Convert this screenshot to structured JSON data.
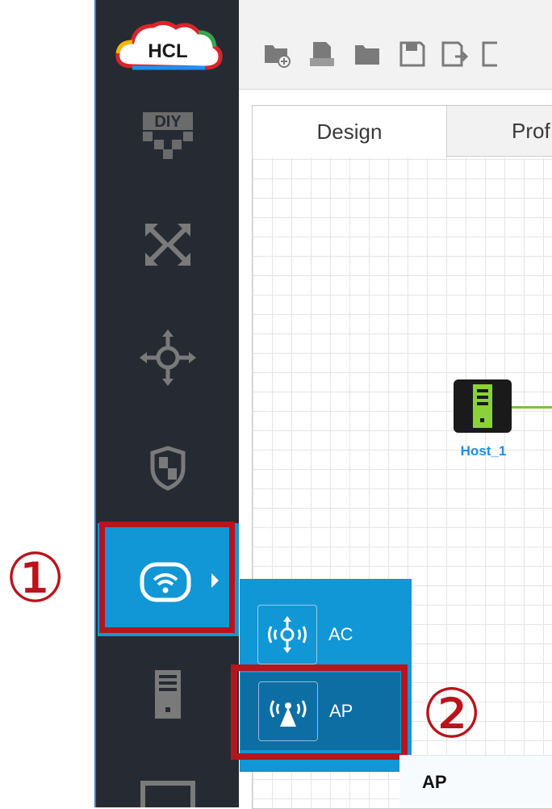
{
  "app": {
    "logo_text": "HCL"
  },
  "sidebar": {
    "items": [
      {
        "name": "diy",
        "label": "DIY",
        "icon": "diy-icon"
      },
      {
        "name": "switch",
        "icon": "cross-arrows-icon"
      },
      {
        "name": "router",
        "icon": "move-arrows-icon"
      },
      {
        "name": "firewall",
        "icon": "shield-icon"
      },
      {
        "name": "wireless",
        "icon": "wifi-icon",
        "selected": true
      },
      {
        "name": "host",
        "icon": "server-icon"
      },
      {
        "name": "monitor",
        "icon": "monitor-icon"
      }
    ]
  },
  "toolbar": {
    "icons": [
      "new-folder-icon",
      "edit-document-icon",
      "open-folder-icon",
      "save-icon",
      "save-as-icon",
      "export-icon"
    ]
  },
  "tabs": {
    "design": "Design",
    "profile": "Prof"
  },
  "canvas": {
    "host_label": "Host_1"
  },
  "popup": {
    "items": [
      {
        "label": "AC",
        "icon": "ac-device-icon"
      },
      {
        "label": "AP",
        "icon": "ap-device-icon"
      }
    ]
  },
  "callouts": {
    "step1": "①",
    "step2": "②"
  },
  "panel": {
    "title": "AP"
  },
  "colors": {
    "sidebar": "#262b33",
    "accent": "#1196d6",
    "highlight": "#b8141c",
    "link": "#7ac143"
  }
}
